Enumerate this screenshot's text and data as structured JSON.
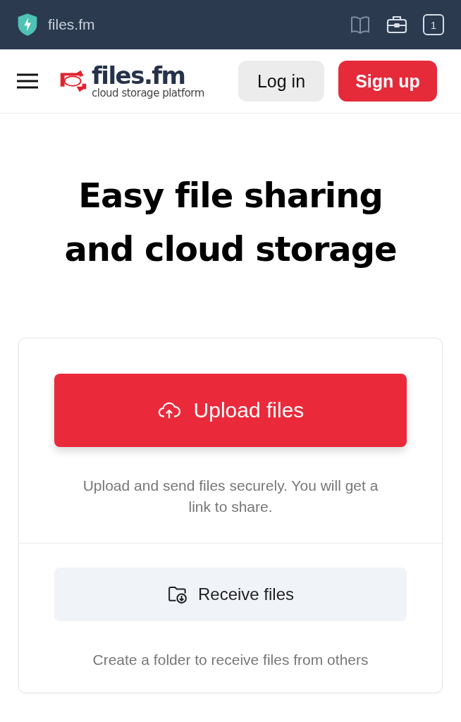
{
  "browser_bar": {
    "url": "files.fm",
    "tab_count": "1"
  },
  "header": {
    "logo": {
      "name": "files.fm",
      "tagline": "cloud storage platform"
    },
    "login": "Log in",
    "signup": "Sign up"
  },
  "hero": {
    "title_lines": [
      "Easy file sharing",
      "and cloud storage"
    ]
  },
  "card": {
    "upload": {
      "label": "Upload files",
      "description": "Upload and send files securely. You will get a link to share."
    },
    "receive": {
      "label": "Receive files",
      "description": "Create a folder to receive files from others"
    }
  }
}
